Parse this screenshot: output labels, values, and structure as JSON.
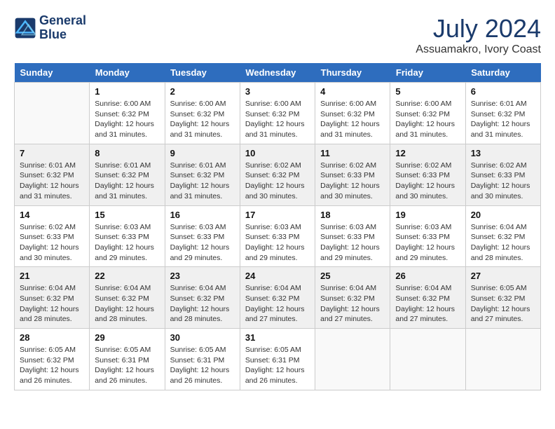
{
  "header": {
    "logo_line1": "General",
    "logo_line2": "Blue",
    "month": "July 2024",
    "location": "Assuamakro, Ivory Coast"
  },
  "columns": [
    "Sunday",
    "Monday",
    "Tuesday",
    "Wednesday",
    "Thursday",
    "Friday",
    "Saturday"
  ],
  "weeks": [
    [
      {
        "day": "",
        "info": ""
      },
      {
        "day": "1",
        "info": "Sunrise: 6:00 AM\nSunset: 6:32 PM\nDaylight: 12 hours\nand 31 minutes."
      },
      {
        "day": "2",
        "info": "Sunrise: 6:00 AM\nSunset: 6:32 PM\nDaylight: 12 hours\nand 31 minutes."
      },
      {
        "day": "3",
        "info": "Sunrise: 6:00 AM\nSunset: 6:32 PM\nDaylight: 12 hours\nand 31 minutes."
      },
      {
        "day": "4",
        "info": "Sunrise: 6:00 AM\nSunset: 6:32 PM\nDaylight: 12 hours\nand 31 minutes."
      },
      {
        "day": "5",
        "info": "Sunrise: 6:00 AM\nSunset: 6:32 PM\nDaylight: 12 hours\nand 31 minutes."
      },
      {
        "day": "6",
        "info": "Sunrise: 6:01 AM\nSunset: 6:32 PM\nDaylight: 12 hours\nand 31 minutes."
      }
    ],
    [
      {
        "day": "7",
        "info": "Sunrise: 6:01 AM\nSunset: 6:32 PM\nDaylight: 12 hours\nand 31 minutes."
      },
      {
        "day": "8",
        "info": "Sunrise: 6:01 AM\nSunset: 6:32 PM\nDaylight: 12 hours\nand 31 minutes."
      },
      {
        "day": "9",
        "info": "Sunrise: 6:01 AM\nSunset: 6:32 PM\nDaylight: 12 hours\nand 31 minutes."
      },
      {
        "day": "10",
        "info": "Sunrise: 6:02 AM\nSunset: 6:32 PM\nDaylight: 12 hours\nand 30 minutes."
      },
      {
        "day": "11",
        "info": "Sunrise: 6:02 AM\nSunset: 6:33 PM\nDaylight: 12 hours\nand 30 minutes."
      },
      {
        "day": "12",
        "info": "Sunrise: 6:02 AM\nSunset: 6:33 PM\nDaylight: 12 hours\nand 30 minutes."
      },
      {
        "day": "13",
        "info": "Sunrise: 6:02 AM\nSunset: 6:33 PM\nDaylight: 12 hours\nand 30 minutes."
      }
    ],
    [
      {
        "day": "14",
        "info": "Sunrise: 6:02 AM\nSunset: 6:33 PM\nDaylight: 12 hours\nand 30 minutes."
      },
      {
        "day": "15",
        "info": "Sunrise: 6:03 AM\nSunset: 6:33 PM\nDaylight: 12 hours\nand 29 minutes."
      },
      {
        "day": "16",
        "info": "Sunrise: 6:03 AM\nSunset: 6:33 PM\nDaylight: 12 hours\nand 29 minutes."
      },
      {
        "day": "17",
        "info": "Sunrise: 6:03 AM\nSunset: 6:33 PM\nDaylight: 12 hours\nand 29 minutes."
      },
      {
        "day": "18",
        "info": "Sunrise: 6:03 AM\nSunset: 6:33 PM\nDaylight: 12 hours\nand 29 minutes."
      },
      {
        "day": "19",
        "info": "Sunrise: 6:03 AM\nSunset: 6:33 PM\nDaylight: 12 hours\nand 29 minutes."
      },
      {
        "day": "20",
        "info": "Sunrise: 6:04 AM\nSunset: 6:32 PM\nDaylight: 12 hours\nand 28 minutes."
      }
    ],
    [
      {
        "day": "21",
        "info": "Sunrise: 6:04 AM\nSunset: 6:32 PM\nDaylight: 12 hours\nand 28 minutes."
      },
      {
        "day": "22",
        "info": "Sunrise: 6:04 AM\nSunset: 6:32 PM\nDaylight: 12 hours\nand 28 minutes."
      },
      {
        "day": "23",
        "info": "Sunrise: 6:04 AM\nSunset: 6:32 PM\nDaylight: 12 hours\nand 28 minutes."
      },
      {
        "day": "24",
        "info": "Sunrise: 6:04 AM\nSunset: 6:32 PM\nDaylight: 12 hours\nand 27 minutes."
      },
      {
        "day": "25",
        "info": "Sunrise: 6:04 AM\nSunset: 6:32 PM\nDaylight: 12 hours\nand 27 minutes."
      },
      {
        "day": "26",
        "info": "Sunrise: 6:04 AM\nSunset: 6:32 PM\nDaylight: 12 hours\nand 27 minutes."
      },
      {
        "day": "27",
        "info": "Sunrise: 6:05 AM\nSunset: 6:32 PM\nDaylight: 12 hours\nand 27 minutes."
      }
    ],
    [
      {
        "day": "28",
        "info": "Sunrise: 6:05 AM\nSunset: 6:32 PM\nDaylight: 12 hours\nand 26 minutes."
      },
      {
        "day": "29",
        "info": "Sunrise: 6:05 AM\nSunset: 6:31 PM\nDaylight: 12 hours\nand 26 minutes."
      },
      {
        "day": "30",
        "info": "Sunrise: 6:05 AM\nSunset: 6:31 PM\nDaylight: 12 hours\nand 26 minutes."
      },
      {
        "day": "31",
        "info": "Sunrise: 6:05 AM\nSunset: 6:31 PM\nDaylight: 12 hours\nand 26 minutes."
      },
      {
        "day": "",
        "info": ""
      },
      {
        "day": "",
        "info": ""
      },
      {
        "day": "",
        "info": ""
      }
    ]
  ]
}
